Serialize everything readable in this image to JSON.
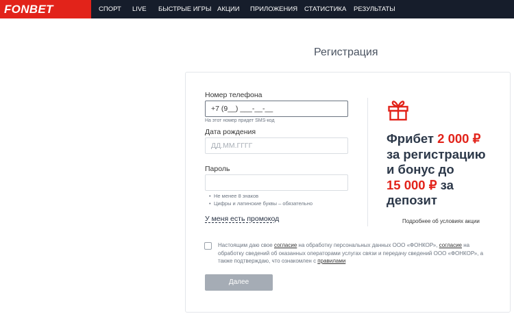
{
  "header": {
    "logo": "FONBET",
    "nav": [
      "СПОРТ",
      "LIVE",
      "БЫСТРЫЕ ИГРЫ",
      "АКЦИИ",
      "ПРИЛОЖЕНИЯ",
      "СТАТИСТИКА",
      "РЕЗУЛЬТАТЫ"
    ]
  },
  "page": {
    "title": "Регистрация"
  },
  "form": {
    "phone_label": "Номер телефона",
    "phone_value": "+7 (9__) ___-__-__",
    "phone_hint": "На этот номер придет SMS-код",
    "dob_label": "Дата рождения",
    "dob_placeholder": "ДД.ММ.ГГГГ",
    "password_label": "Пароль",
    "password_rules": [
      "Не менее 8 знаков",
      "Цифры и латинские буквы – обязательно"
    ],
    "promo_link": "У меня есть промокод",
    "consent_parts": {
      "p1": "Настоящим даю свое ",
      "link1": "согласие",
      "p2": " на обработку персональных данных ООО «ФОНКОР», ",
      "link2": "согласие",
      "p3": " на обработку сведений об оказанных операторами услугах связи и передачу сведений ООО «ФОНКОР», а также подтверждаю, что ознакомлен с ",
      "link3": "правилами"
    },
    "submit_label": "Далее"
  },
  "promo": {
    "line1_a": "Фрибет ",
    "line1_b": "2 000 ₽",
    "line2": "за регистрацию",
    "line3": "и бонус до",
    "line4_a": "15 000 ₽",
    "line4_b": " за",
    "line5": "депозит",
    "terms_link": "Подробнее об условиях акции",
    "accent_color": "#e2231a"
  }
}
